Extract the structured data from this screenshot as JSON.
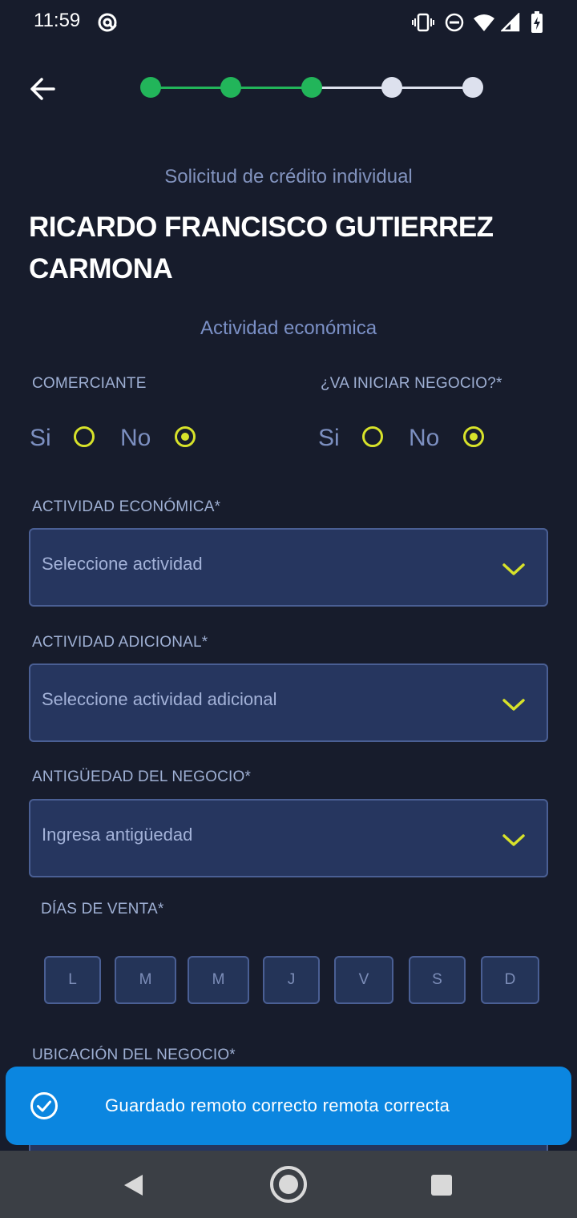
{
  "status_bar": {
    "time": "11:59"
  },
  "header": {
    "back_icon": "arrow-left-icon",
    "progress": {
      "total_steps": 5,
      "completed_steps": 3
    }
  },
  "form": {
    "subtitle": "Solicitud de crédito individual",
    "client_name_line1": "RICARDO FRANCISCO GUTIERREZ",
    "client_name_line2": "CARMONA",
    "section_title": "Actividad económica",
    "comerciante": {
      "label": "COMERCIANTE",
      "yes": "Si",
      "no": "No",
      "selected": "No"
    },
    "iniciar_negocio": {
      "label": "¿VA INICIAR NEGOCIO?*",
      "yes": "Si",
      "no": "No",
      "selected": "No"
    },
    "actividad_economica": {
      "label": "ACTIVIDAD ECONÓMICA*",
      "placeholder": "Seleccione actividad"
    },
    "actividad_adicional": {
      "label": "ACTIVIDAD ADICIONAL*",
      "placeholder": "Seleccione actividad adicional"
    },
    "antiguedad": {
      "label": "ANTIGÜEDAD DEL NEGOCIO*",
      "placeholder": "Ingresa antigüedad"
    },
    "dias_venta": {
      "label": "DÍAS DE VENTA*",
      "days": [
        "L",
        "M",
        "M",
        "J",
        "V",
        "S",
        "D"
      ]
    },
    "ubicacion": {
      "label": "UBICACIÓN DEL NEGOCIO*"
    }
  },
  "toast": {
    "icon": "check-circle-icon",
    "message": "Guardado remoto correcto remota correcta"
  },
  "colors": {
    "background": "#171c2c",
    "step_done": "#22b55a",
    "step_pending": "#dde1ee",
    "accent": "#d7e22a",
    "input_bg": "#26365f",
    "toast_bg": "#0b86e0"
  }
}
